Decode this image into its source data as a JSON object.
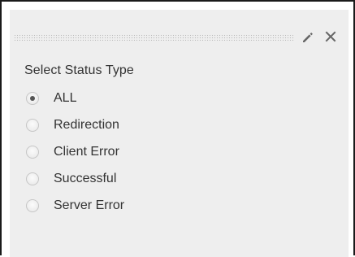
{
  "widget": {
    "title": "",
    "edit_icon": "pencil-icon",
    "close_icon": "close-icon",
    "group_label": "Select Status Type",
    "selected": "ALL",
    "options": [
      {
        "label": "ALL",
        "checked": true
      },
      {
        "label": "Redirection",
        "checked": false
      },
      {
        "label": "Client Error",
        "checked": false
      },
      {
        "label": "Successful",
        "checked": false
      },
      {
        "label": "Server Error",
        "checked": false
      }
    ]
  },
  "colors": {
    "panel_background": "#eeeeee",
    "text": "#333333",
    "icon": "#666666",
    "frame_border": "#1a1a1a"
  }
}
